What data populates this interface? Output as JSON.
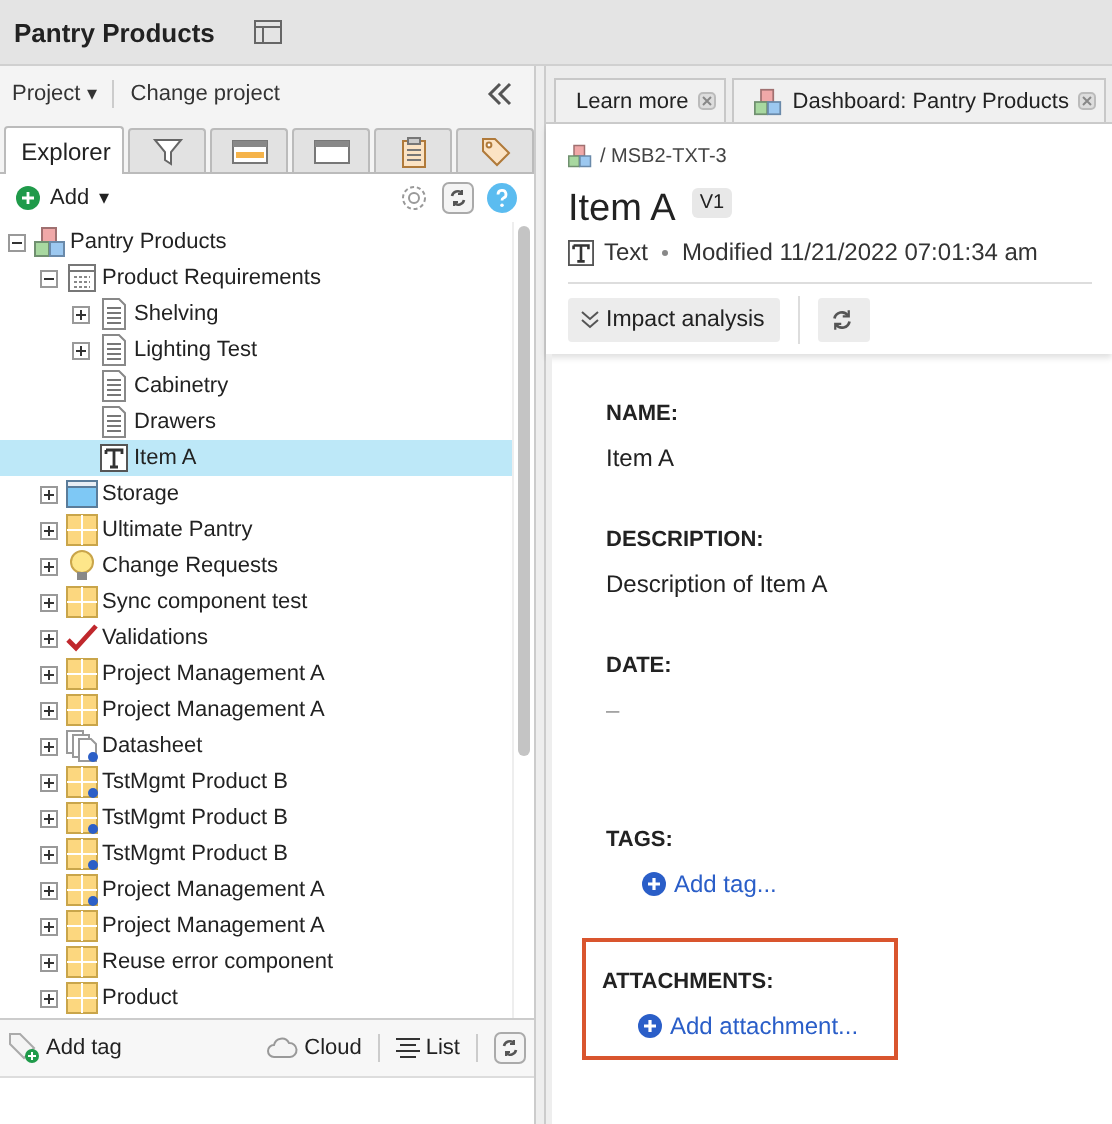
{
  "app_title": "Pantry Products",
  "project_bar": {
    "project_menu": "Project",
    "caret": "▾",
    "change_project": "Change project"
  },
  "explorer_tabs": [
    {
      "kind": "explorer",
      "label": "Explorer",
      "selected": true
    },
    {
      "kind": "filter",
      "selected": false
    },
    {
      "kind": "calendar",
      "selected": false
    },
    {
      "kind": "window",
      "selected": false
    },
    {
      "kind": "clipboard",
      "selected": false
    },
    {
      "kind": "tag",
      "selected": false
    }
  ],
  "add_button": {
    "label": "Add",
    "caret": "▾"
  },
  "tree": [
    {
      "label": "Pantry Products",
      "kind": "project",
      "expanded": true,
      "linked": false,
      "selected": false,
      "children": [
        {
          "label": "Product Requirements",
          "kind": "module",
          "expanded": true,
          "linked": false,
          "selected": false,
          "children": [
            {
              "label": "Shelving",
              "kind": "document",
              "expanded": false,
              "linked": false,
              "selected": false
            },
            {
              "label": "Lighting Test",
              "kind": "document",
              "expanded": false,
              "linked": false,
              "selected": false
            },
            {
              "label": "Cabinetry",
              "kind": "document",
              "linked": false,
              "selected": false
            },
            {
              "label": "Drawers",
              "kind": "document",
              "linked": false,
              "selected": false
            },
            {
              "label": "Item A",
              "kind": "text",
              "linked": false,
              "selected": true
            }
          ]
        },
        {
          "label": "Storage",
          "kind": "storage",
          "expanded": false,
          "linked": false,
          "selected": false
        },
        {
          "label": "Ultimate Pantry",
          "kind": "folder",
          "expanded": false,
          "linked": false,
          "selected": false
        },
        {
          "label": "Change Requests",
          "kind": "bulb",
          "expanded": false,
          "linked": false,
          "selected": false
        },
        {
          "label": "Sync component test",
          "kind": "folder",
          "expanded": false,
          "linked": false,
          "selected": false
        },
        {
          "label": "Validations",
          "kind": "check",
          "expanded": false,
          "linked": false,
          "selected": false
        },
        {
          "label": "Project Management A",
          "kind": "folder",
          "expanded": false,
          "linked": false,
          "selected": false
        },
        {
          "label": "Project Management A",
          "kind": "folder",
          "expanded": false,
          "linked": false,
          "selected": false
        },
        {
          "label": "Datasheet",
          "kind": "pages",
          "expanded": false,
          "linked": true,
          "selected": false
        },
        {
          "label": "TstMgmt Product B",
          "kind": "folder",
          "expanded": false,
          "linked": true,
          "selected": false
        },
        {
          "label": "TstMgmt Product B",
          "kind": "folder",
          "expanded": false,
          "linked": true,
          "selected": false
        },
        {
          "label": "TstMgmt Product B",
          "kind": "folder",
          "expanded": false,
          "linked": true,
          "selected": false
        },
        {
          "label": "Project Management A",
          "kind": "folder",
          "expanded": false,
          "linked": true,
          "selected": false
        },
        {
          "label": "Project Management A",
          "kind": "folder",
          "expanded": false,
          "linked": false,
          "selected": false
        },
        {
          "label": "Reuse error component",
          "kind": "folder",
          "expanded": false,
          "linked": false,
          "selected": false
        },
        {
          "label": "Product",
          "kind": "folder",
          "expanded": false,
          "linked": false,
          "selected": false
        }
      ]
    }
  ],
  "bottom_bar": {
    "add_tag": "Add tag",
    "cloud": "Cloud",
    "list": "List"
  },
  "doc_tabs": [
    {
      "label": "Learn more",
      "kind": "plain",
      "selected": false
    },
    {
      "label": "Dashboard: Pantry Products",
      "kind": "project",
      "selected": false
    }
  ],
  "breadcrumb": "/ MSB2-TXT-3",
  "item": {
    "title": "Item A",
    "version": "V1",
    "type": "Text",
    "modified": "Modified 11/21/2022 07:01:34 am"
  },
  "actions": {
    "impact": "Impact analysis"
  },
  "fields": [
    {
      "kind": "text",
      "label": "NAME:",
      "value": "Item A",
      "highlighted": false
    },
    {
      "kind": "text",
      "label": "DESCRIPTION:",
      "value": "Description of Item A",
      "highlighted": false
    },
    {
      "kind": "empty",
      "label": "DATE:",
      "value": "–",
      "highlighted": false
    },
    {
      "kind": "link",
      "label": "TAGS:",
      "value": "Add tag...",
      "highlighted": false
    },
    {
      "kind": "link",
      "label": "ATTACHMENTS:",
      "value": "Add attachment...",
      "highlighted": true
    }
  ]
}
